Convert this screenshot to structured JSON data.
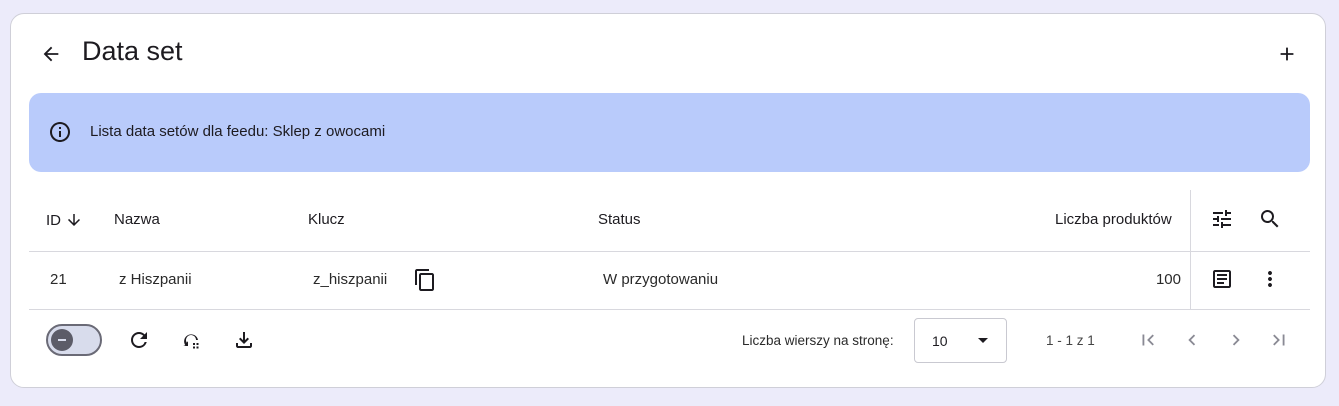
{
  "header": {
    "title": "Data set",
    "back_icon": "arrow-left-icon",
    "add_icon": "plus-icon"
  },
  "banner": {
    "text": "Lista data setów dla feedu: Sklep z owocami",
    "icon": "info-icon",
    "color": "#b9cbfb"
  },
  "table": {
    "columns": {
      "id": "ID",
      "name": "Nazwa",
      "key": "Klucz",
      "status": "Status",
      "products": "Liczba produktów"
    },
    "sort": {
      "column": "id",
      "direction": "desc"
    },
    "rows": [
      {
        "id": "21",
        "name": "z Hiszpanii",
        "key": "z_hiszpanii",
        "status": "W przygotowaniu",
        "products": "100"
      }
    ]
  },
  "footer": {
    "rows_per_page_label": "Liczba wierszy na stronę:",
    "rows_per_page_value": "10",
    "range_text": "1 - 1 z 1"
  }
}
